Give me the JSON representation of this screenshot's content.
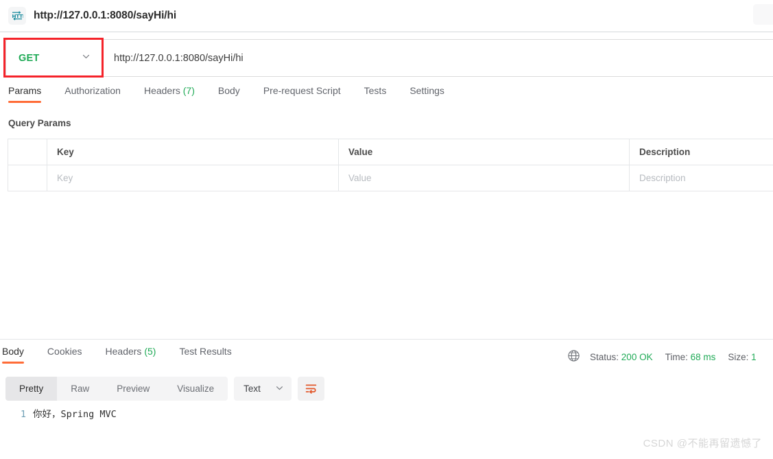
{
  "request_tab": {
    "protocol_icon": "http-icon",
    "title": "http://127.0.0.1:8080/sayHi/hi",
    "overflow_button": "more-actions-button"
  },
  "url_bar": {
    "method": "GET",
    "method_caret": "chevron-down-icon",
    "url": "http://127.0.0.1:8080/sayHi/hi",
    "annotation": "red-highlight-rectangle"
  },
  "request_tabs": [
    {
      "label": "Params",
      "count": "",
      "active": true
    },
    {
      "label": "Authorization",
      "count": "",
      "active": false
    },
    {
      "label": "Headers",
      "count": "(7)",
      "active": false
    },
    {
      "label": "Body",
      "count": "",
      "active": false
    },
    {
      "label": "Pre-request Script",
      "count": "",
      "active": false
    },
    {
      "label": "Tests",
      "count": "",
      "active": false
    },
    {
      "label": "Settings",
      "count": "",
      "active": false
    }
  ],
  "query_params": {
    "section_title": "Query Params",
    "columns": [
      "",
      "Key",
      "Value",
      "Description"
    ],
    "rows": [
      {
        "key": "Key",
        "value": "Value",
        "description": "Description"
      }
    ]
  },
  "response": {
    "tabs": [
      {
        "label": "Body",
        "count": "",
        "active": true
      },
      {
        "label": "Cookies",
        "count": "",
        "active": false
      },
      {
        "label": "Headers",
        "count": "(5)",
        "active": false
      },
      {
        "label": "Test Results",
        "count": "",
        "active": false
      }
    ],
    "meta": {
      "globe_icon": "globe-icon",
      "status_label": "Status:",
      "status_value": "200 OK",
      "time_label": "Time:",
      "time_value": "68 ms",
      "size_label": "Size:",
      "size_value": "1"
    },
    "viewer": {
      "modes": [
        "Pretty",
        "Raw",
        "Preview",
        "Visualize"
      ],
      "active_mode": "Pretty",
      "format": "Text",
      "format_caret": "chevron-down-icon",
      "wrap_button": "word-wrap-icon"
    },
    "body": {
      "lines": [
        {
          "number": "1",
          "text": "你好，Spring MVC"
        }
      ]
    }
  },
  "watermark": "CSDN @不能再留遗憾了",
  "colors": {
    "accent_orange": "#ff6c37",
    "status_green": "#1faa56",
    "annotation_red": "#f5232a",
    "icon_teal": "#1b8c9e"
  }
}
